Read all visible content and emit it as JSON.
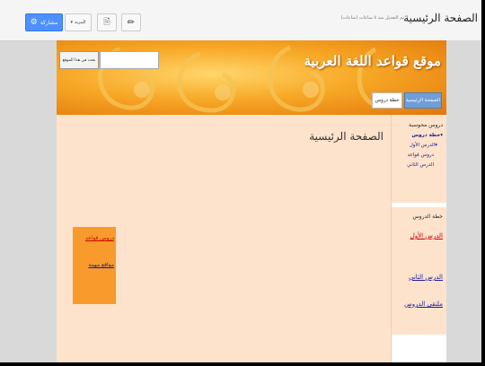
{
  "toolbar": {
    "site_title": "الصفحة الرئيسية",
    "edit_info": "تم التعديل منذ ٥ ساعات (ساعات)",
    "share_label": "مشاركة",
    "more_label": "المزيد",
    "share_icon": "gear-icon",
    "page_icon": "new-page-icon",
    "edit_icon": "pencil-icon"
  },
  "site": {
    "title": "موقع قواعد اللغة العربية",
    "search_button": "بحث في هذا الموقع",
    "search_value": "",
    "nav": [
      "الصفحة الرئيسية",
      "خطة دروس"
    ]
  },
  "sidebar": {
    "section1": {
      "heading": "دروس محوسبة",
      "items": [
        "خطة دروس",
        "الدرس الأول",
        "دروس قواعد",
        "الدرس الثاني"
      ]
    },
    "section2": {
      "heading": "خطة الدروس",
      "links": [
        "الدرس الأول",
        "الدرس الثاني",
        "ملتقى الدروس"
      ]
    }
  },
  "main": {
    "heading": "الصفحة الرئيسية",
    "box_links": [
      "دروس قواعد",
      "مواقع مهمة"
    ]
  },
  "colors": {
    "accent": "#4d90fe",
    "banner": "#f7a826",
    "page_bg": "#fde3cc",
    "box": "#f89b2c",
    "link_red": "#cc0000",
    "link_blue": "#1a1a9c"
  }
}
